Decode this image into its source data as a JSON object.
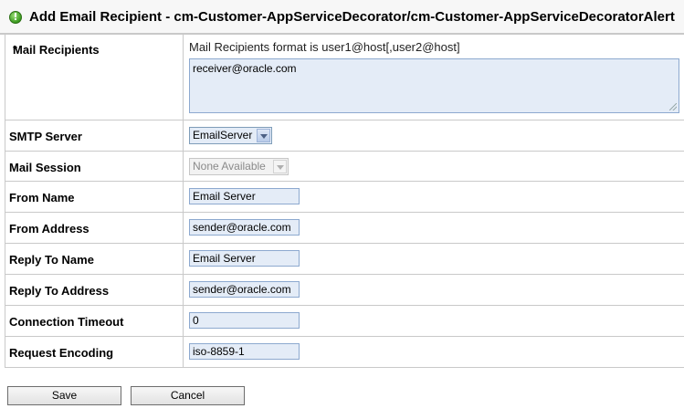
{
  "header": {
    "title": "Add Email Recipient - cm-Customer-AppServiceDecorator/cm-Customer-AppServiceDecoratorAlert"
  },
  "form": {
    "mail_recipients": {
      "label": "Mail Recipients",
      "required_mark": "*",
      "hint": "Mail Recipients format is user1@host[,user2@host]",
      "value": "receiver@oracle.com"
    },
    "smtp_server": {
      "label": "SMTP Server",
      "value": "EmailServer"
    },
    "mail_session": {
      "label": "Mail Session",
      "value": "None Available"
    },
    "from_name": {
      "label": "From Name",
      "value": "Email Server"
    },
    "from_address": {
      "label": "From Address",
      "value": "sender@oracle.com"
    },
    "reply_to_name": {
      "label": "Reply To Name",
      "value": "Email Server"
    },
    "reply_to_address": {
      "label": "Reply To Address",
      "value": "sender@oracle.com"
    },
    "connection_timeout": {
      "label": "Connection Timeout",
      "value": "0"
    },
    "request_encoding": {
      "label": "Request Encoding",
      "value": "iso-8859-1"
    }
  },
  "buttons": {
    "save": "Save",
    "cancel": "Cancel"
  },
  "icons": {
    "header_icon": "alert-icon",
    "header_icon_color": "#3a9a1e"
  }
}
